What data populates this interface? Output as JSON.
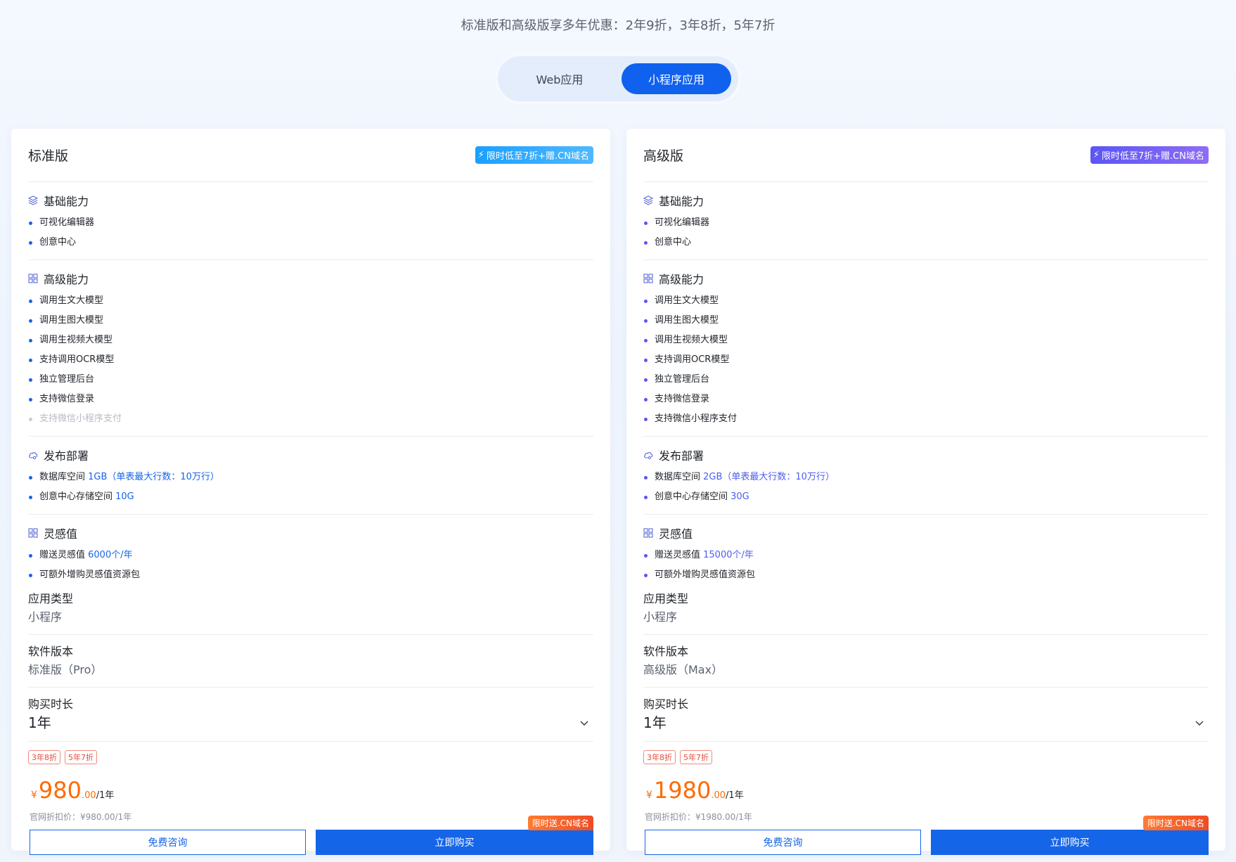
{
  "header": {
    "note": "标准版和高级版享多年优惠：2年9折，3年8折，5年7折"
  },
  "tabs": [
    {
      "label": "Web应用",
      "active": false
    },
    {
      "label": "小程序应用",
      "active": true
    }
  ],
  "colors": {
    "primary": "#1565e8",
    "price": "#ff6a00",
    "tag_red": "#e34b3b",
    "promo_blue": "#1aa0ff",
    "promo_purple": "#5a56f5"
  },
  "plans": [
    {
      "title": "标准版",
      "promo_badge": "限时低至7折+赠.CN域名",
      "sections": {
        "basic": {
          "icon": "layers-icon",
          "title": "基础能力",
          "items": [
            "可视化编辑器",
            "创意中心"
          ]
        },
        "advanced": {
          "icon": "grid-icon",
          "title": "高级能力",
          "items": [
            "调用生文大模型",
            "调用生图大模型",
            "调用生视频大模型",
            "支持调用OCR模型",
            "独立管理后台",
            "支持微信登录",
            "支持微信小程序支付"
          ],
          "disabled_index": 6
        },
        "deploy": {
          "icon": "cloud-icon",
          "title": "发布部署",
          "db_label": "数据库空间 ",
          "db_value": "1GB（单表最大行数：10万行）",
          "storage_label": "创意中心存储空间 ",
          "storage_value": "10G"
        },
        "inspiration": {
          "icon": "grid-icon",
          "title": "灵感值",
          "gift_label": "赠送灵感值 ",
          "gift_value": "6000个/年",
          "extra": "可额外增购灵感值资源包"
        }
      },
      "app_type_label": "应用类型",
      "app_type_value": "小程序",
      "version_label": "软件版本",
      "version_value": "标准版（Pro）",
      "duration_label": "购买时长",
      "duration_value": "1年",
      "discount_tags": [
        "3年8折",
        "5年7折"
      ],
      "price": {
        "currency": "¥",
        "integer": "980",
        "decimal": ".00",
        "unit": "/1年"
      },
      "original_price": "官网折扣价：¥980.00/1年",
      "consult_label": "免费咨询",
      "buy_label": "立即购买",
      "buy_corner_tag": "限时送.CN域名"
    },
    {
      "title": "高级版",
      "promo_badge": "限时低至7折+赠.CN域名",
      "sections": {
        "basic": {
          "icon": "layers-icon",
          "title": "基础能力",
          "items": [
            "可视化编辑器",
            "创意中心"
          ]
        },
        "advanced": {
          "icon": "grid-icon",
          "title": "高级能力",
          "items": [
            "调用生文大模型",
            "调用生图大模型",
            "调用生视频大模型",
            "支持调用OCR模型",
            "独立管理后台",
            "支持微信登录",
            "支持微信小程序支付"
          ],
          "disabled_index": -1
        },
        "deploy": {
          "icon": "cloud-icon",
          "title": "发布部署",
          "db_label": "数据库空间 ",
          "db_value": "2GB（单表最大行数：10万行）",
          "storage_label": "创意中心存储空间 ",
          "storage_value": "30G"
        },
        "inspiration": {
          "icon": "grid-icon",
          "title": "灵感值",
          "gift_label": "赠送灵感值 ",
          "gift_value": "15000个/年",
          "extra": "可额外增购灵感值资源包"
        }
      },
      "app_type_label": "应用类型",
      "app_type_value": "小程序",
      "version_label": "软件版本",
      "version_value": "高级版（Max）",
      "duration_label": "购买时长",
      "duration_value": "1年",
      "discount_tags": [
        "3年8折",
        "5年7折"
      ],
      "price": {
        "currency": "¥",
        "integer": "1980",
        "decimal": ".00",
        "unit": "/1年"
      },
      "original_price": "官网折扣价：¥1980.00/1年",
      "consult_label": "免费咨询",
      "buy_label": "立即购买",
      "buy_corner_tag": "限时送.CN域名"
    }
  ]
}
